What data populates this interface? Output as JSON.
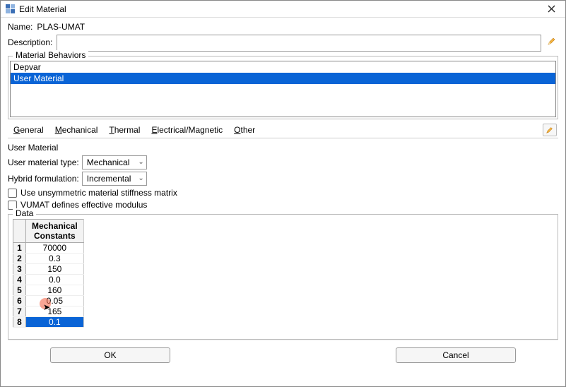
{
  "window": {
    "title": "Edit Material"
  },
  "name": {
    "label": "Name:",
    "value": "PLAS-UMAT"
  },
  "description": {
    "label": "Description:",
    "value": ""
  },
  "behaviors": {
    "legend": "Material Behaviors",
    "items": [
      {
        "label": "Depvar",
        "selected": false
      },
      {
        "label": "User Material",
        "selected": true
      }
    ]
  },
  "tabs": {
    "general": "General",
    "mechanical": "Mechanical",
    "thermal": "Thermal",
    "electrical": "Electrical/Magnetic",
    "other": "Other"
  },
  "section_title": "User Material",
  "form": {
    "material_type": {
      "label": "User material type:",
      "value": "Mechanical"
    },
    "hybrid": {
      "label": "Hybrid formulation:",
      "value": "Incremental"
    },
    "unsymmetric": {
      "label": "Use unsymmetric material stiffness matrix",
      "checked": false
    },
    "vumat": {
      "label": "VUMAT defines effective modulus",
      "checked": false
    }
  },
  "data": {
    "legend": "Data",
    "header": "Mechanical\nConstants",
    "rows": [
      {
        "n": "1",
        "v": "70000",
        "selected": false
      },
      {
        "n": "2",
        "v": "0.3",
        "selected": false
      },
      {
        "n": "3",
        "v": "150",
        "selected": false
      },
      {
        "n": "4",
        "v": "0.0",
        "selected": false
      },
      {
        "n": "5",
        "v": "160",
        "selected": false
      },
      {
        "n": "6",
        "v": "0.05",
        "selected": false
      },
      {
        "n": "7",
        "v": "165",
        "selected": false
      },
      {
        "n": "8",
        "v": "0.1",
        "selected": true
      }
    ]
  },
  "buttons": {
    "ok": "OK",
    "cancel": "Cancel"
  }
}
